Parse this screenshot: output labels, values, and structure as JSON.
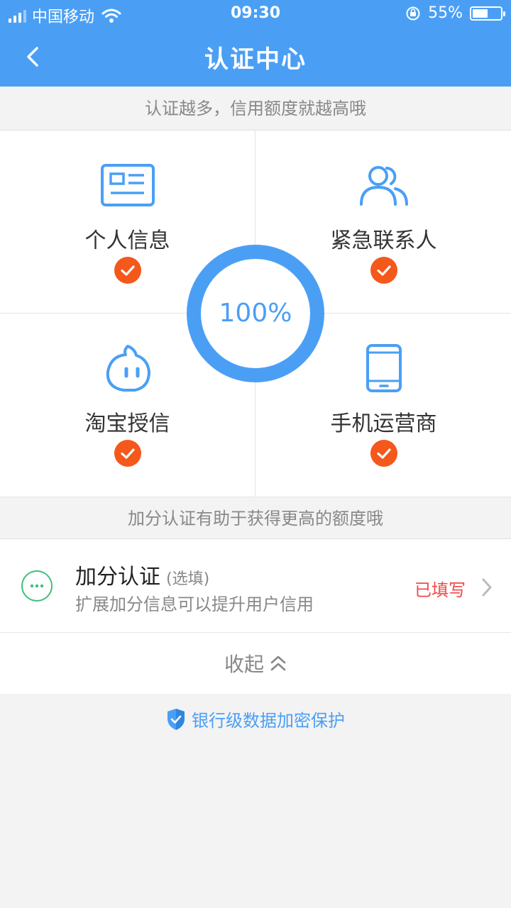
{
  "status_bar": {
    "carrier": "中国移动",
    "time": "09:30",
    "battery_percent": "55%",
    "battery_level": 0.55,
    "icons": [
      "signal-icon",
      "wifi-icon",
      "orientation-lock-icon",
      "battery-icon"
    ]
  },
  "header": {
    "title": "认证中心",
    "back_icon": "chevron-left-icon",
    "background_color": "#4a9ff5"
  },
  "tip_top": "认证越多，信用额度就越高哦",
  "progress": {
    "value": 1.0,
    "label": "100%",
    "ring_color": "#4a9ff5"
  },
  "items": [
    {
      "label": "个人信息",
      "icon": "id-card-icon",
      "completed": true
    },
    {
      "label": "紧急联系人",
      "icon": "contacts-icon",
      "completed": true
    },
    {
      "label": "淘宝授信",
      "icon": "taobao-icon",
      "completed": true
    },
    {
      "label": "手机运营商",
      "icon": "mobile-phone-icon",
      "completed": true
    }
  ],
  "tip_bonus": "加分认证有助于获得更高的额度哦",
  "bonus": {
    "title": "加分认证",
    "optional": "(选填)",
    "description": "扩展加分信息可以提升用户信用",
    "status": "已填写",
    "status_color": "#ef4a4a",
    "icon": "more-dots-icon"
  },
  "collapse": {
    "label": "收起",
    "icon": "double-chevron-up-icon"
  },
  "security": {
    "label": "银行级数据加密保护",
    "icon": "shield-check-icon"
  },
  "colors": {
    "accent": "#4a9ff5",
    "check": "#f4581b",
    "bonus_icon": "#3fbf7a"
  }
}
